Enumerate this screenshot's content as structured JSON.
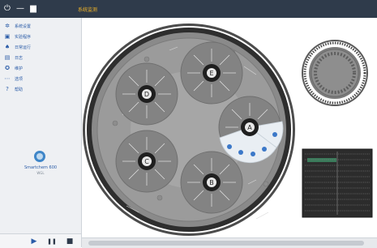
{
  "window": {
    "title": "系统监测",
    "controls": {
      "power": "⏻",
      "minimize": "—",
      "maximize": "▆"
    }
  },
  "sidebar": {
    "items": [
      {
        "icon": "gear-icon",
        "glyph": "✲",
        "label": "系统设置"
      },
      {
        "icon": "checklist-icon",
        "glyph": "▣",
        "label": "实验程序"
      },
      {
        "icon": "flask-icon",
        "glyph": "♠",
        "label": "日常运行"
      },
      {
        "icon": "document-icon",
        "glyph": "▤",
        "label": "日志"
      },
      {
        "icon": "maintenance-icon",
        "glyph": "✪",
        "label": "维护"
      },
      {
        "icon": "more-icon",
        "glyph": "⋯",
        "label": "选项"
      },
      {
        "icon": "help-icon",
        "glyph": "?",
        "label": "帮助"
      }
    ]
  },
  "brand": {
    "name": "Smartchem 600",
    "subtitle": "WGL"
  },
  "run_controls": {
    "play": "▶",
    "pause": "❚❚",
    "stop": "■"
  },
  "carousel": {
    "trays": [
      "A",
      "B",
      "C",
      "D",
      "E"
    ],
    "active_tray": "A"
  },
  "colors": {
    "titlebar": "#2f3b4b",
    "accent_title": "#f0b428",
    "menu_text": "#2b5ca8",
    "tray_dark": "#1f1f1f",
    "plate_grid": "#3a7a5a"
  }
}
